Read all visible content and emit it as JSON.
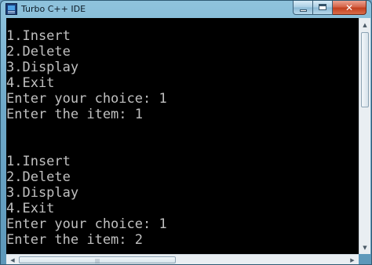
{
  "window": {
    "title": "Turbo C++ IDE",
    "icon": "turbo-cpp-app-icon"
  },
  "caption_buttons": {
    "minimize_icon": "minimize-icon",
    "maximize_icon": "maximize-icon",
    "close_label": "✕"
  },
  "console": {
    "text_color": "#c0c0c0",
    "background": "#000000",
    "lines": [
      "1.Insert",
      "2.Delete",
      "3.Display",
      "4.Exit",
      "Enter your choice: 1",
      "Enter the item: 1",
      "",
      "",
      "1.Insert",
      "2.Delete",
      "3.Display",
      "4.Exit",
      "Enter your choice: 1",
      "Enter the item: 2"
    ]
  },
  "scrollbars": {
    "up_arrow": "▲",
    "down_arrow": "▼",
    "left_arrow": "◀",
    "right_arrow": "▶",
    "grip": "|||"
  }
}
